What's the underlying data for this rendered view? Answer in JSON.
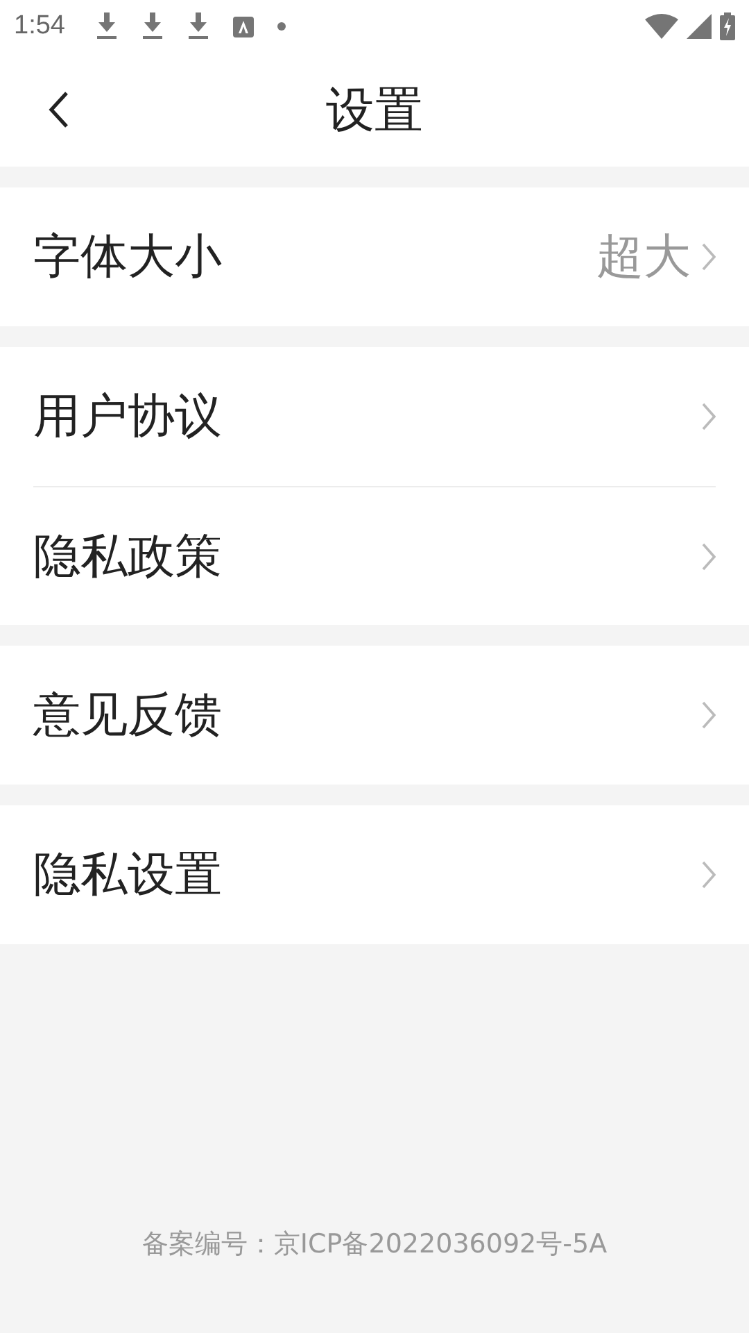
{
  "status_bar": {
    "time": "1:54"
  },
  "header": {
    "title": "设置"
  },
  "groups": [
    {
      "items": [
        {
          "label": "字体大小",
          "value": "超大"
        }
      ]
    },
    {
      "items": [
        {
          "label": "用户协议"
        },
        {
          "label": "隐私政策"
        }
      ]
    },
    {
      "items": [
        {
          "label": "意见反馈"
        }
      ]
    },
    {
      "items": [
        {
          "label": "隐私设置"
        }
      ]
    }
  ],
  "footer": "备案编号：京ICP备2022036092号-5A"
}
